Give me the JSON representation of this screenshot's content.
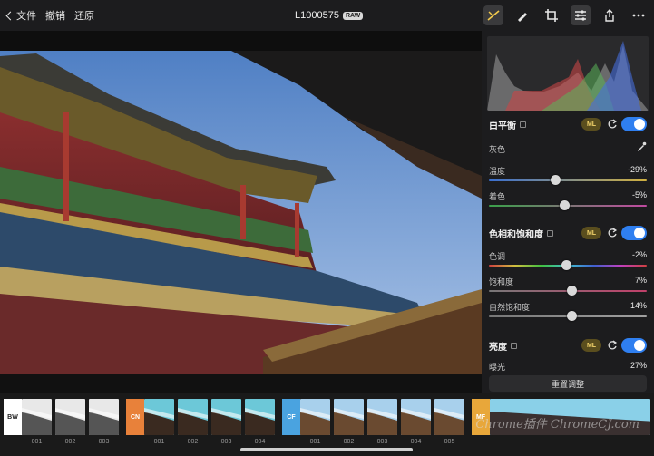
{
  "toolbar": {
    "back_label": "文件",
    "undo_label": "撤销",
    "redo_label": "还原",
    "file_name": "L1000575",
    "format_badge": "RAW",
    "icons": [
      "adjust-icon",
      "brush-icon",
      "crop-icon",
      "sliders-icon",
      "share-icon",
      "more-icon"
    ]
  },
  "panel": {
    "white_balance": {
      "title": "白平衡",
      "ml_label": "ML",
      "enabled": true,
      "gray_label": "灰色",
      "temperature": {
        "label": "温度",
        "value": "-29%",
        "level": -0.29
      },
      "tint": {
        "label": "着色",
        "value": "-5%",
        "level": -0.05
      }
    },
    "hue_saturation": {
      "title": "色相和饱和度",
      "ml_label": "ML",
      "enabled": true,
      "hue": {
        "label": "色调",
        "value": "-2%",
        "level": -0.02
      },
      "saturation": {
        "label": "饱和度",
        "value": "7%",
        "level": 0.07
      },
      "vibrance": {
        "label": "自然饱和度",
        "value": "14%",
        "level": 0.14
      }
    },
    "brightness": {
      "title": "亮度",
      "ml_label": "ML",
      "enabled": true,
      "exposure": {
        "label": "曝光",
        "value": "27%"
      }
    },
    "reset_label": "重置调整"
  },
  "filmstrip": {
    "groups": [
      {
        "badge": "BW",
        "color": "#ffffff",
        "text_color": "#222222",
        "items": [
          "001",
          "002",
          "003"
        ]
      },
      {
        "badge": "CN",
        "color": "#e8813a",
        "text_color": "#ffffff",
        "items": [
          "001",
          "002",
          "003",
          "004"
        ]
      },
      {
        "badge": "CF",
        "color": "#4aa3e0",
        "text_color": "#ffffff",
        "items": [
          "001",
          "002",
          "003",
          "004",
          "005"
        ]
      },
      {
        "badge": "MF",
        "color": "#e8a73a",
        "text_color": "#ffffff",
        "items": []
      }
    ]
  },
  "watermark": "Chrome插件 ChromeCJ.com",
  "colors": {
    "accent_toggle": "#2f7ff0",
    "ml_badge_bg": "#5a4e1e",
    "ml_badge_text": "#f2d36b"
  }
}
